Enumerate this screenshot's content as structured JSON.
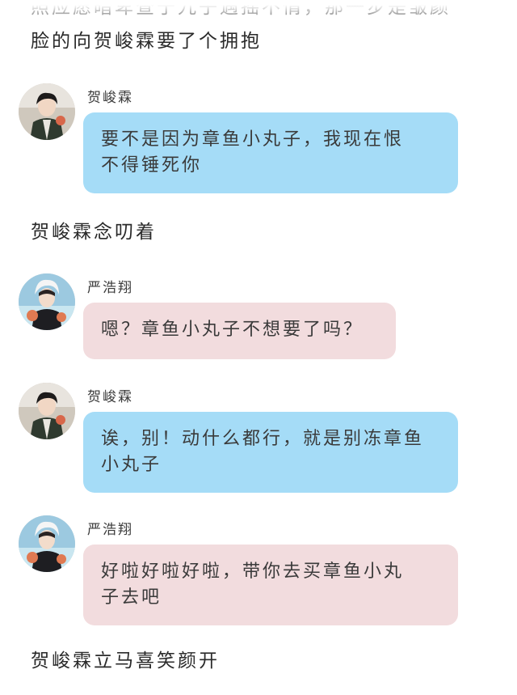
{
  "narration": [
    "照应愿暗卑查于九子遇摇不情，那一步是皱颜",
    "脸的向贺峻霖要了个拥抱",
    "贺峻霖念叨着",
    "贺峻霖立马喜笑颜开"
  ],
  "messages": [
    {
      "speaker": "贺峻霖",
      "avatar": "avatar-he-junlin",
      "bubble_color": "#a5dcf7",
      "text_lines": [
        "要不是因为章鱼小丸子，我现在恨",
        "不得锤死你"
      ]
    },
    {
      "speaker": "严浩翔",
      "avatar": "avatar-yan-haoxiang",
      "bubble_color": "#f2dcde",
      "text_lines": [
        "嗯？章鱼小丸子不想要了吗？"
      ]
    },
    {
      "speaker": "贺峻霖",
      "avatar": "avatar-he-junlin",
      "bubble_color": "#a5dcf7",
      "text_lines": [
        "诶，别！动什么都行，就是别冻章鱼",
        "小丸子"
      ]
    },
    {
      "speaker": "严浩翔",
      "avatar": "avatar-yan-haoxiang",
      "bubble_color": "#f2dcde",
      "text_lines": [
        "好啦好啦好啦，带你去买章鱼小丸",
        "子去吧"
      ]
    }
  ]
}
